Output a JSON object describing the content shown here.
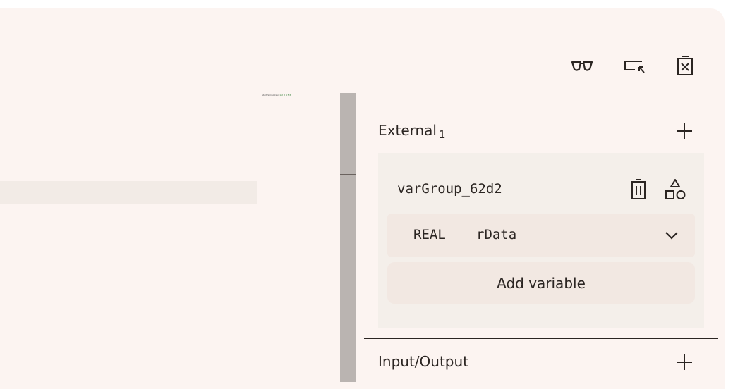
{
  "toolbar": {
    "icons": [
      "glasses-icon",
      "select-arrow-icon",
      "delete-box-icon"
    ]
  },
  "left_pane": {
    "tiny_text": "Start Simulation",
    "tiny_text_green": "1 2 3 4 5 6"
  },
  "panel": {
    "external": {
      "title": "External",
      "count": "1"
    },
    "group": {
      "name": "varGroup_62d2",
      "variables": [
        {
          "type": "REAL",
          "name": "rData"
        }
      ],
      "add_variable_label": "Add variable"
    },
    "input_output": {
      "title": "Input/Output"
    }
  },
  "colors": {
    "background": "#fcf4f1",
    "card": "#f4efea",
    "row": "#f2e8e2",
    "scrollbar": "#bab4b1",
    "text": "#2b2522"
  }
}
